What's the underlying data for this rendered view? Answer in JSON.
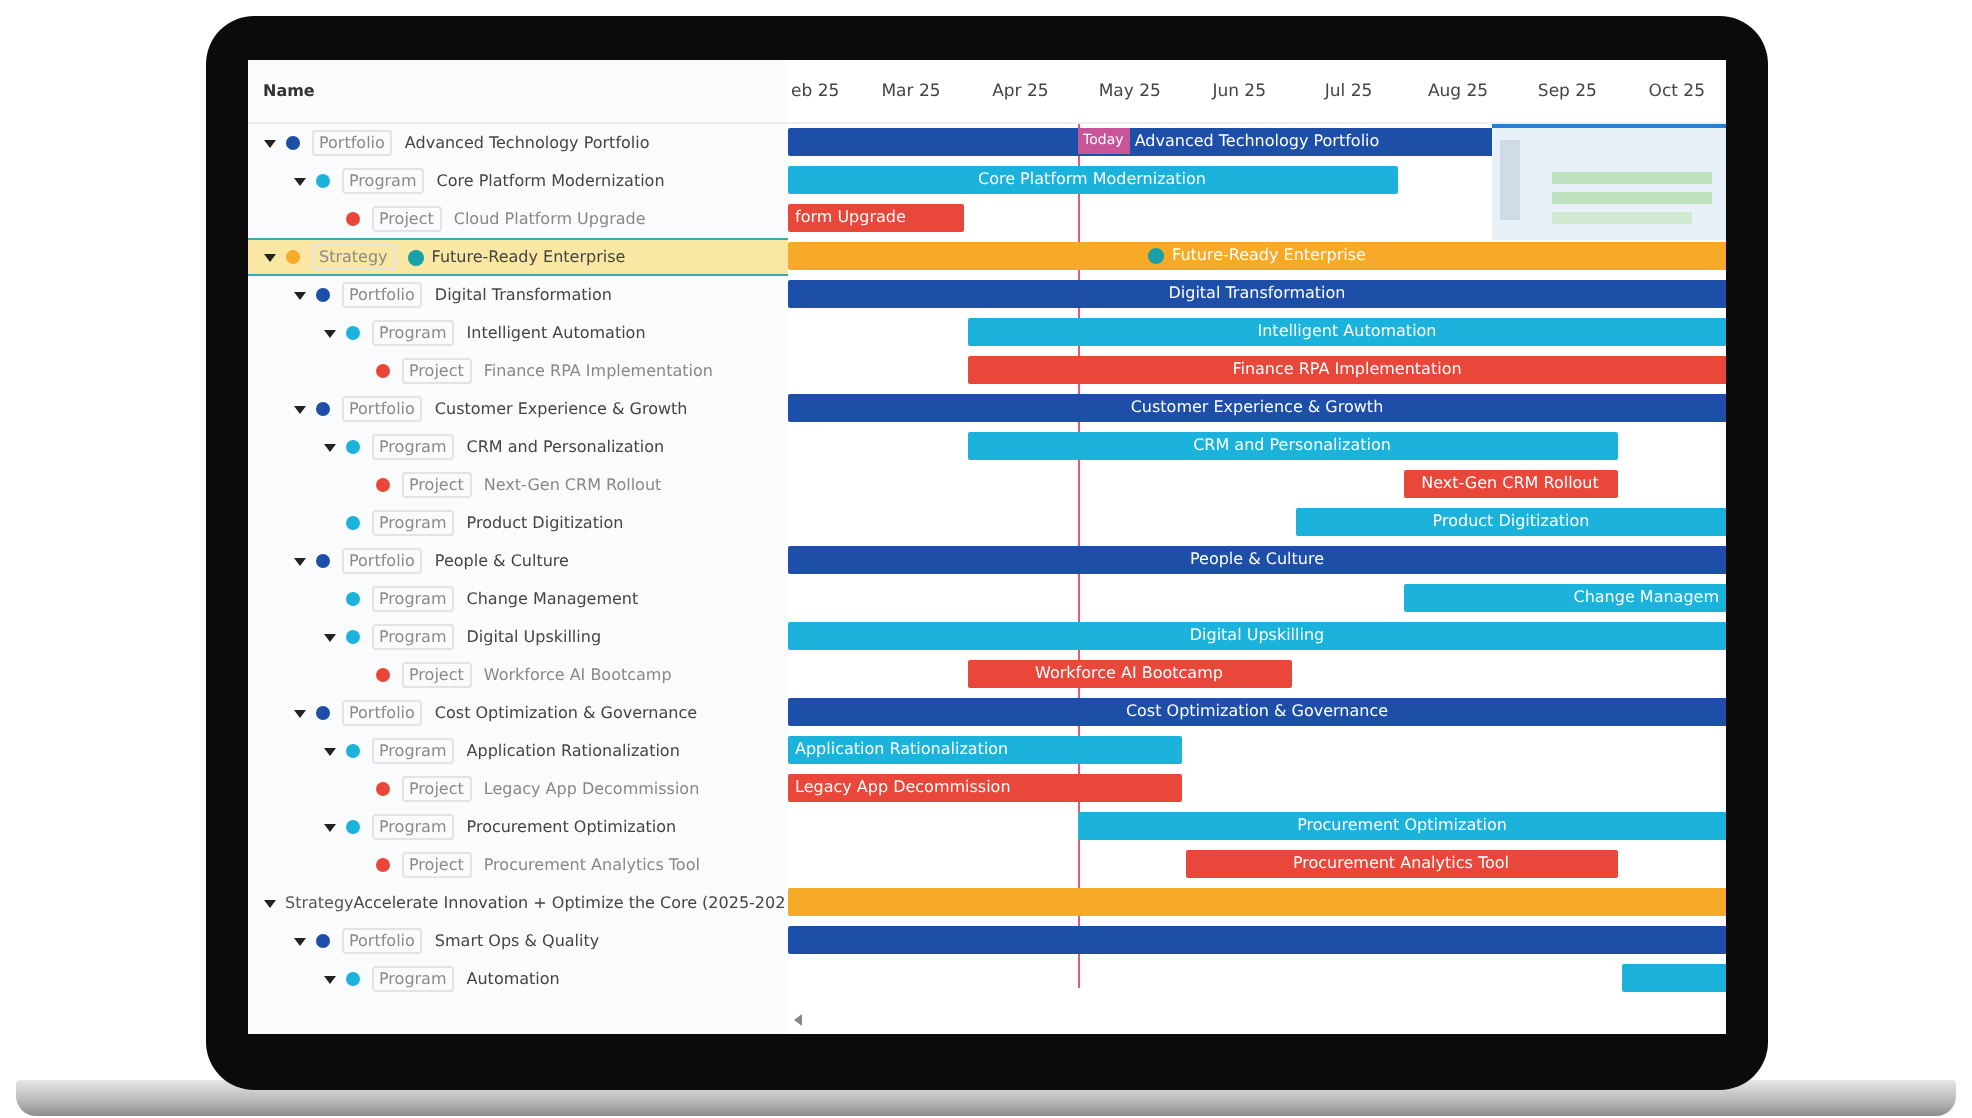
{
  "header": {
    "name_column": "Name",
    "months": [
      "eb 25",
      "Mar 25",
      "Apr 25",
      "May 25",
      "Jun 25",
      "Jul 25",
      "Aug 25",
      "Sep 25",
      "Oct 25"
    ]
  },
  "today": {
    "label": "Today"
  },
  "tree": [
    {
      "type": "Portfolio",
      "name": "Advanced Technology Portfolio",
      "color": "#1d4fa8",
      "expanded": true,
      "selected": false,
      "bar": {
        "label": "Advanced Technology Portfolio",
        "color": "#1d4fa8"
      },
      "children": [
        {
          "type": "Program",
          "name": "Core Platform Modernization",
          "color": "#1bb3dc",
          "expanded": true,
          "selected": false,
          "bar": {
            "label": "Core Platform Modernization",
            "color": "#1bb3dc"
          },
          "children": [
            {
              "type": "Project",
              "name": "Cloud Platform Upgrade",
              "color": "#e8473a",
              "selected": false,
              "bar": {
                "label": "form Upgrade",
                "color": "#e8473a"
              }
            }
          ]
        }
      ]
    },
    {
      "type": "Strategy",
      "name": "Future-Ready Enterprise",
      "color": "#f7a928",
      "goal_icon": true,
      "expanded": true,
      "selected": true,
      "bar": {
        "label": "Future-Ready Enterprise",
        "color": "#f7a928",
        "goal_icon": true
      },
      "children": [
        {
          "type": "Portfolio",
          "name": "Digital Transformation",
          "color": "#1d4fa8",
          "expanded": true,
          "selected": false,
          "bar": {
            "label": "Digital Transformation",
            "color": "#1d4fa8"
          },
          "children": [
            {
              "type": "Program",
              "name": "Intelligent Automation",
              "color": "#1bb3dc",
              "expanded": true,
              "selected": false,
              "bar": {
                "label": "Intelligent Automation",
                "color": "#1bb3dc"
              },
              "children": [
                {
                  "type": "Project",
                  "name": "Finance RPA Implementation",
                  "color": "#e8473a",
                  "selected": false,
                  "bar": {
                    "label": "Finance RPA Implementation",
                    "color": "#e8473a"
                  }
                }
              ]
            }
          ]
        },
        {
          "type": "Portfolio",
          "name": "Customer Experience & Growth",
          "color": "#1d4fa8",
          "expanded": true,
          "selected": false,
          "bar": {
            "label": "Customer Experience & Growth",
            "color": "#1d4fa8"
          },
          "children": [
            {
              "type": "Program",
              "name": "CRM and Personalization",
              "color": "#1bb3dc",
              "expanded": true,
              "selected": false,
              "bar": {
                "label": "CRM and Personalization",
                "color": "#1bb3dc"
              },
              "children": [
                {
                  "type": "Project",
                  "name": "Next-Gen CRM Rollout",
                  "color": "#e8473a",
                  "selected": false,
                  "bar": {
                    "label": "Next-Gen CRM Rollout",
                    "color": "#e8473a"
                  }
                }
              ]
            },
            {
              "type": "Program",
              "name": "Product Digitization",
              "color": "#1bb3dc",
              "selected": false,
              "bar": {
                "label": "Product Digitization",
                "color": "#1bb3dc"
              }
            }
          ]
        },
        {
          "type": "Portfolio",
          "name": "People & Culture",
          "color": "#1d4fa8",
          "expanded": true,
          "selected": false,
          "bar": {
            "label": "People & Culture",
            "color": "#1d4fa8"
          },
          "children": [
            {
              "type": "Program",
              "name": "Change Management",
              "color": "#1bb3dc",
              "selected": false,
              "bar": {
                "label": "Change Managem",
                "color": "#1bb3dc"
              }
            },
            {
              "type": "Program",
              "name": "Digital Upskilling",
              "color": "#1bb3dc",
              "expanded": true,
              "selected": false,
              "bar": {
                "label": "Digital Upskilling",
                "color": "#1bb3dc"
              },
              "children": [
                {
                  "type": "Project",
                  "name": "Workforce AI Bootcamp",
                  "color": "#e8473a",
                  "selected": false,
                  "bar": {
                    "label": "Workforce AI Bootcamp",
                    "color": "#e8473a"
                  }
                }
              ]
            }
          ]
        },
        {
          "type": "Portfolio",
          "name": "Cost Optimization & Governance",
          "color": "#1d4fa8",
          "expanded": true,
          "selected": false,
          "bar": {
            "label": "Cost Optimization & Governance",
            "color": "#1d4fa8"
          },
          "children": [
            {
              "type": "Program",
              "name": "Application Rationalization",
              "color": "#1bb3dc",
              "expanded": true,
              "selected": false,
              "bar": {
                "label": "Application Rationalization",
                "color": "#1bb3dc"
              },
              "children": [
                {
                  "type": "Project",
                  "name": "Legacy App Decommission",
                  "color": "#e8473a",
                  "selected": false,
                  "bar": {
                    "label": "Legacy App Decommission",
                    "color": "#e8473a"
                  }
                }
              ]
            },
            {
              "type": "Program",
              "name": "Procurement Optimization",
              "color": "#1bb3dc",
              "expanded": true,
              "selected": false,
              "bar": {
                "label": "Procurement Optimization",
                "color": "#1bb3dc"
              },
              "children": [
                {
                  "type": "Project",
                  "name": "Procurement Analytics Tool",
                  "color": "#e8473a",
                  "selected": false,
                  "bar": {
                    "label": "Procurement Analytics Tool",
                    "color": "#e8473a"
                  }
                }
              ]
            }
          ]
        }
      ]
    },
    {
      "type": "Strategy",
      "name": "Accelerate Innovation + Optimize the Core (2025-202",
      "expanded": true,
      "selected": false,
      "bar": {
        "color": "#f7a928"
      },
      "children": [
        {
          "type": "Portfolio",
          "name": "Smart Ops & Quality",
          "color": "#1d4fa8",
          "expanded": true,
          "selected": false,
          "bar": {
            "color": "#1d4fa8"
          },
          "children": [
            {
              "type": "Program",
              "name": "Automation",
              "color": "#1bb3dc",
              "expanded": true,
              "selected": false,
              "bar": {
                "color": "#1bb3dc"
              }
            }
          ]
        }
      ]
    }
  ]
}
